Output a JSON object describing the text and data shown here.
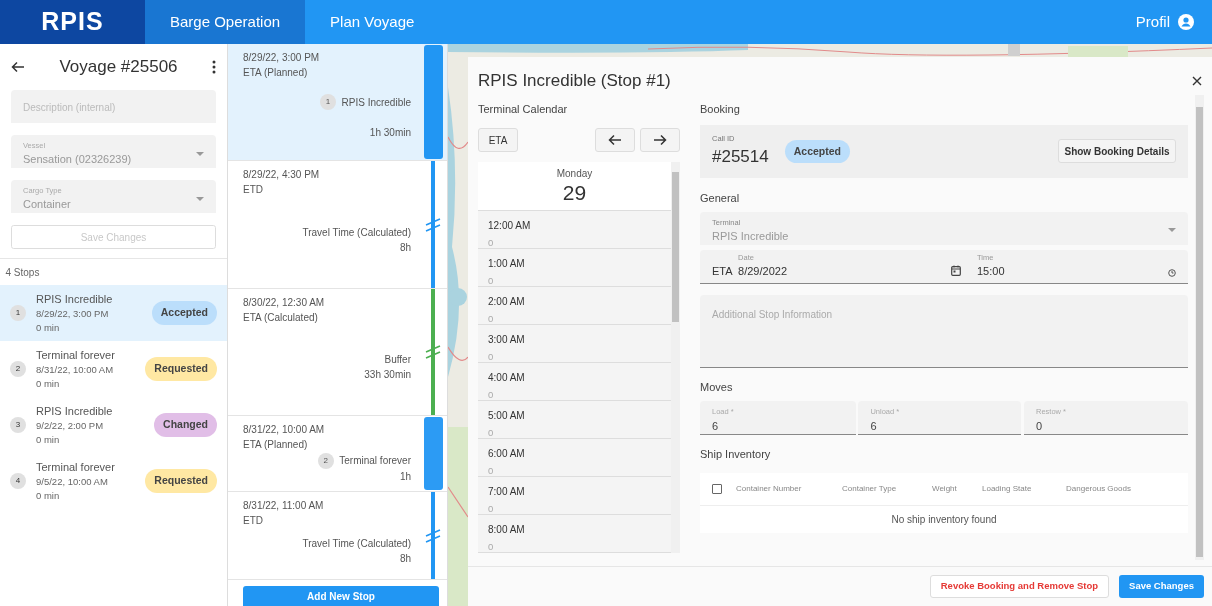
{
  "nav": {
    "brand": "RPIS",
    "tabs": [
      {
        "label": "Barge Operation",
        "selected": true
      },
      {
        "label": "Plan Voyage",
        "selected": false
      }
    ],
    "profile": "Profil"
  },
  "voyage": {
    "title": "Voyage #25506",
    "description": {
      "placeholder": "Description (internal)"
    },
    "vessel": {
      "label": "Vessel",
      "value": "Sensation (02326239)"
    },
    "cargo": {
      "label": "Cargo Type",
      "value": "Container"
    },
    "save_button": {
      "label": "Save Changes",
      "disabled": true
    },
    "stops_count": "4 Stops",
    "stops": [
      {
        "number": "1",
        "name": "RPIS Incredible",
        "datetime": "8/29/22, 3:00 PM",
        "duration": "0 min",
        "status": "Accepted",
        "color": "#bbdefb",
        "selected": true
      },
      {
        "number": "2",
        "name": "Terminal forever",
        "datetime": "8/31/22, 10:00 AM",
        "duration": "0 min",
        "status": "Requested",
        "color": "#ffe8a3",
        "selected": false
      },
      {
        "number": "3",
        "name": "RPIS Incredible",
        "datetime": "9/2/22, 2:00 PM",
        "duration": "0 min",
        "status": "Changed",
        "color": "#e1bee7",
        "selected": false
      },
      {
        "number": "4",
        "name": "Terminal forever",
        "datetime": "9/5/22, 10:00 AM",
        "duration": "0 min",
        "status": "Requested",
        "color": "#ffe8a3",
        "selected": false
      }
    ]
  },
  "timeline": {
    "segments": [
      {
        "kind": "stop",
        "time": "8/29/22, 3:00 PM",
        "event": "ETA (Planned)",
        "number": "1",
        "name": "RPIS Incredible",
        "duration": "1h 30min",
        "selected": true
      },
      {
        "kind": "gap",
        "time": "8/29/22, 4:30 PM",
        "event": "ETD",
        "name": "Travel Time (Calculated)",
        "duration": "8h",
        "color": "#2196f3"
      },
      {
        "kind": "gap",
        "time": "8/30/22, 12:30 AM",
        "event": "ETA (Calculated)",
        "name": "Buffer",
        "duration": "33h 30min",
        "color": "#4caf50"
      },
      {
        "kind": "stop",
        "time": "8/31/22, 10:00 AM",
        "event": "ETA (Planned)",
        "number": "2",
        "name": "Terminal forever",
        "duration": "1h",
        "selected": false
      },
      {
        "kind": "gap",
        "time": "8/31/22, 11:00 AM",
        "event": "ETD",
        "name": "Travel Time (Calculated)",
        "duration": "8h",
        "color": "#2196f3"
      }
    ],
    "add_button": "Add New Stop"
  },
  "dialog": {
    "title": "RPIS Incredible (Stop #1)",
    "calendar": {
      "heading": "Terminal Calendar",
      "eta_button": "ETA",
      "day_name": "Monday",
      "day_number": "29",
      "slots": [
        {
          "time": "12:00 AM",
          "count": "0"
        },
        {
          "time": "1:00 AM",
          "count": "0"
        },
        {
          "time": "2:00 AM",
          "count": "0"
        },
        {
          "time": "3:00 AM",
          "count": "0"
        },
        {
          "time": "4:00 AM",
          "count": "0"
        },
        {
          "time": "5:00 AM",
          "count": "0"
        },
        {
          "time": "6:00 AM",
          "count": "0"
        },
        {
          "time": "7:00 AM",
          "count": "0"
        },
        {
          "time": "8:00 AM",
          "count": "0"
        }
      ]
    },
    "booking": {
      "heading": "Booking",
      "call_id_label": "Call ID",
      "call_id": "#25514",
      "status": {
        "label": "Accepted",
        "color": "#bbdefb"
      },
      "details_button": "Show Booking Details"
    },
    "general": {
      "heading": "General",
      "terminal": {
        "label": "Terminal",
        "value": "RPIS Incredible",
        "disabled": true
      },
      "eta_label": "ETA",
      "date": {
        "label": "Date",
        "value": "8/29/2022"
      },
      "time": {
        "label": "Time",
        "value": "15:00"
      },
      "additional": {
        "placeholder": "Additional Stop Information"
      }
    },
    "moves": {
      "heading": "Moves",
      "fields": [
        {
          "label": "Load *",
          "value": "6"
        },
        {
          "label": "Unload *",
          "value": "6"
        },
        {
          "label": "Restow *",
          "value": "0"
        }
      ]
    },
    "inventory": {
      "heading": "Ship Inventory",
      "select_all_checked": false,
      "columns": [
        "Container Number",
        "Container Type",
        "Weight",
        "Loading State",
        "Dangerous Goods"
      ],
      "empty_text": "No ship inventory found"
    },
    "revoke_button": "Revoke Booking and Remove Stop",
    "save_button": "Save Changes"
  }
}
